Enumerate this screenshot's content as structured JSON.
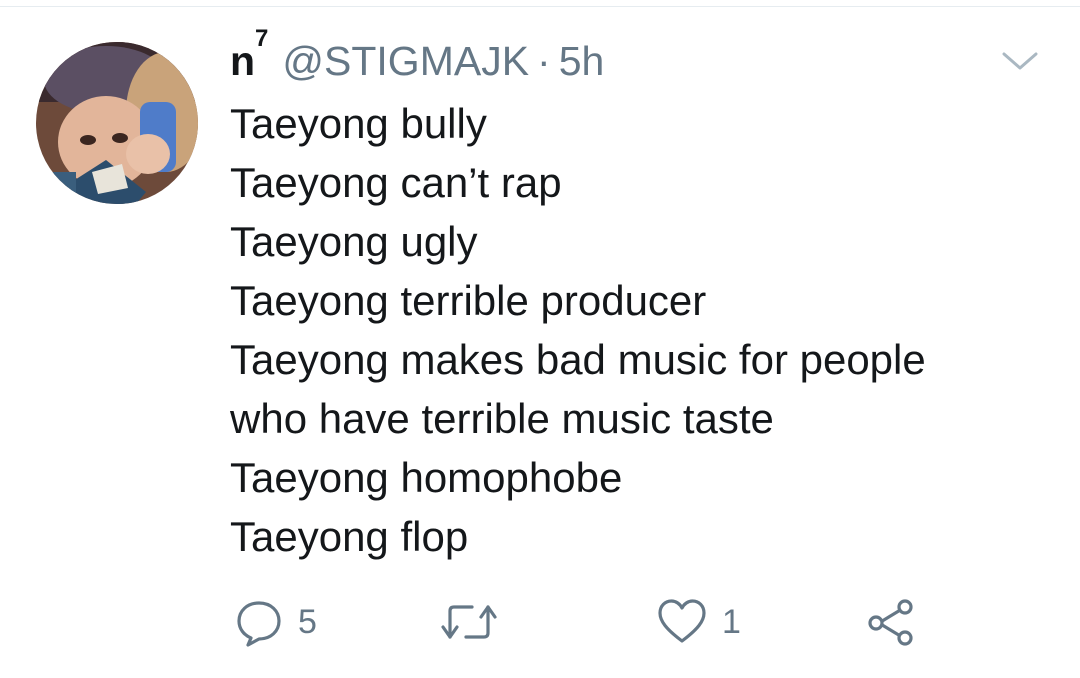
{
  "tweet": {
    "display_name": "n",
    "name_superscript": "7",
    "handle": "@STIGMAJK",
    "separator": "·",
    "time": "5h",
    "lines": [
      "Taeyong bully",
      "Taeyong can’t rap",
      "Taeyong ugly",
      "Taeyong terrible producer",
      "Taeyong makes bad music for people",
      "who have terrible music taste",
      "Taeyong homophobe",
      "Taeyong flop"
    ]
  },
  "actions": {
    "reply_count": "5",
    "retweet_count": "",
    "like_count": "1"
  },
  "icons": {
    "reply": "reply-icon",
    "retweet": "retweet-icon",
    "like": "heart-icon",
    "share": "share-icon",
    "caret": "chevron-down-icon"
  },
  "colors": {
    "text": "#14171a",
    "secondary": "#657786"
  }
}
